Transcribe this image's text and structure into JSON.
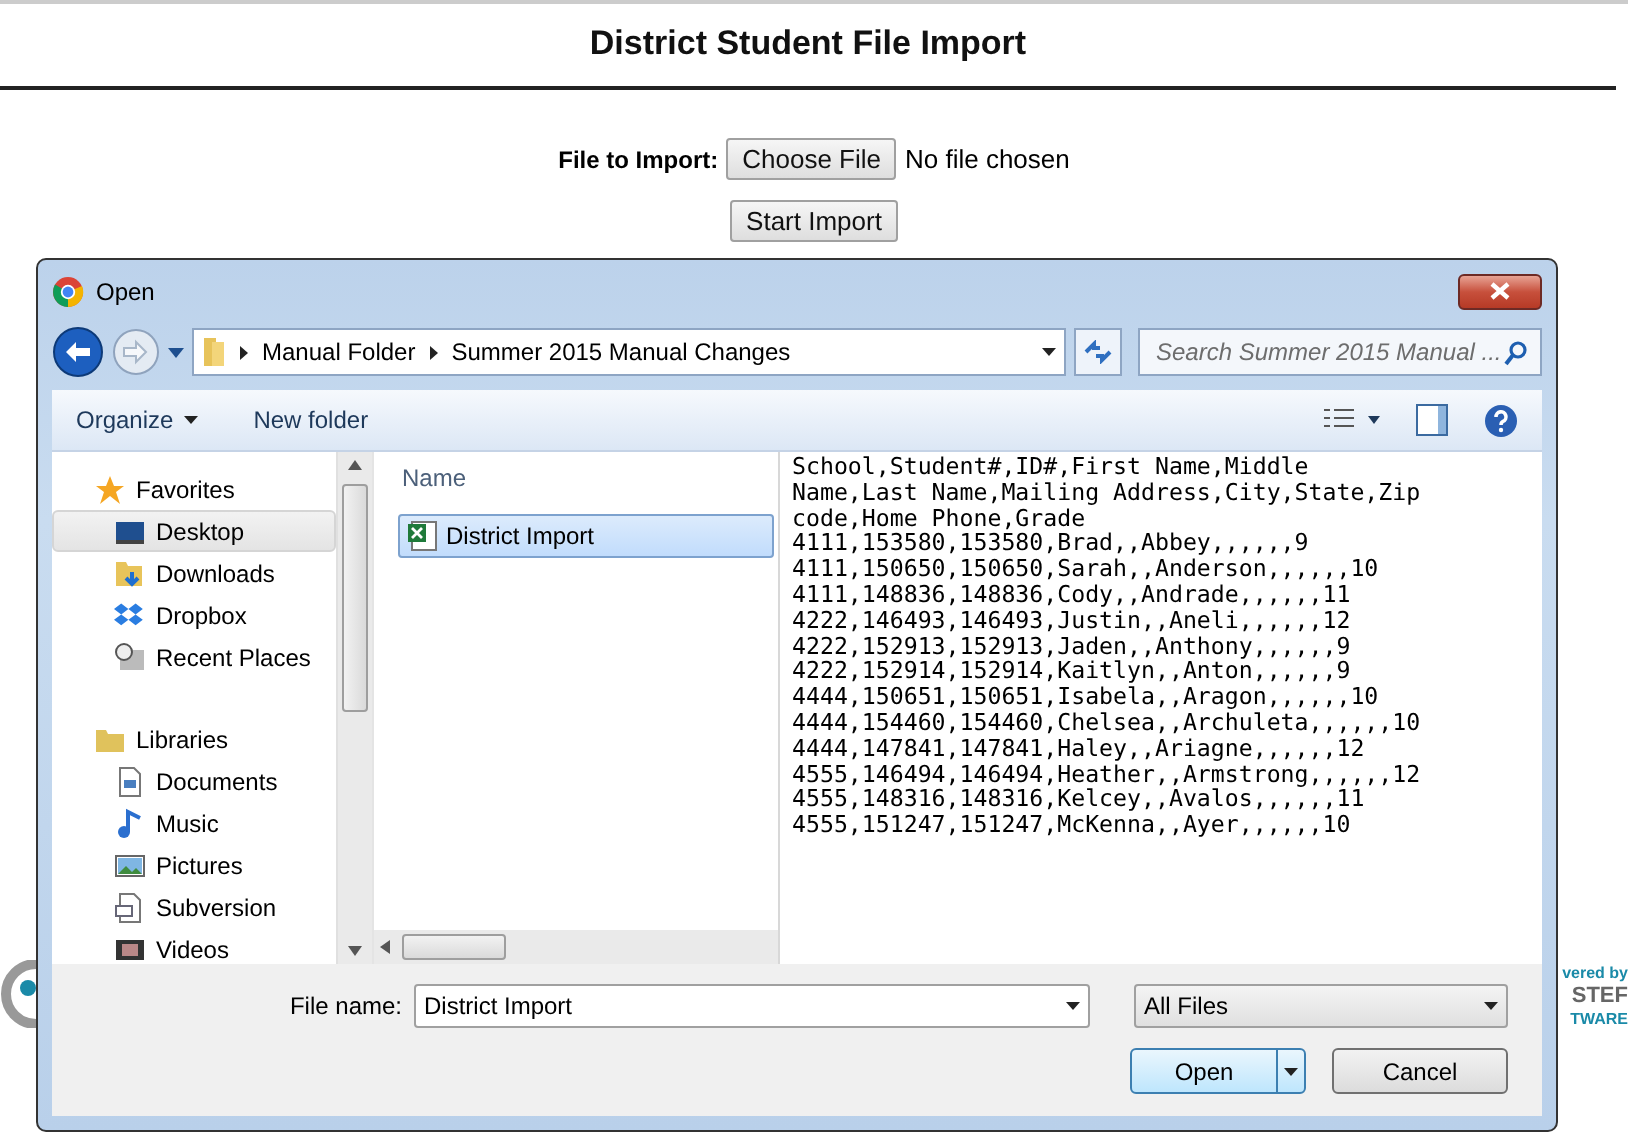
{
  "page": {
    "title": "District Student File Import",
    "file_label": "File to Import:",
    "choose_button": "Choose File",
    "no_file": "No file chosen",
    "start_button": "Start Import",
    "footer_text": [
      "vered by",
      "STEF",
      "TWARE"
    ]
  },
  "dialog": {
    "title": "Open",
    "breadcrumb": [
      "Manual Folder",
      "Summer 2015 Manual Changes"
    ],
    "search_placeholder": "Search Summer 2015 Manual ...",
    "toolbar": [
      "Organize",
      "New folder"
    ],
    "nav": [
      {
        "label": "Favorites",
        "kind": "group",
        "selected": false
      },
      {
        "label": "Desktop",
        "kind": "item",
        "selected": true
      },
      {
        "label": "Downloads",
        "kind": "item",
        "selected": false
      },
      {
        "label": "Dropbox",
        "kind": "item",
        "selected": false
      },
      {
        "label": "Recent Places",
        "kind": "item",
        "selected": false
      },
      {
        "label": "Libraries",
        "kind": "group",
        "selected": false
      },
      {
        "label": "Documents",
        "kind": "item",
        "selected": false
      },
      {
        "label": "Music",
        "kind": "item",
        "selected": false
      },
      {
        "label": "Pictures",
        "kind": "item",
        "selected": false
      },
      {
        "label": "Subversion",
        "kind": "item",
        "selected": false
      },
      {
        "label": "Videos",
        "kind": "item",
        "selected": false
      }
    ],
    "files": {
      "column": "Name",
      "items": [
        {
          "name": "District Import",
          "selected": true
        }
      ]
    },
    "preview": [
      "School,Student#,ID#,First Name,Middle",
      "Name,Last Name,Mailing Address,City,State,Zip",
      "code,Home Phone,Grade",
      "4111,153580,153580,Brad,,Abbey,,,,,,9",
      "4111,150650,150650,Sarah,,Anderson,,,,,,10",
      "4111,148836,148836,Cody,,Andrade,,,,,,11",
      "4222,146493,146493,Justin,,Aneli,,,,,,12",
      "4222,152913,152913,Jaden,,Anthony,,,,,,9",
      "4222,152914,152914,Kaitlyn,,Anton,,,,,,9",
      "4444,150651,150651,Isabela,,Aragon,,,,,,10",
      "4444,154460,154460,Chelsea,,Archuleta,,,,,,10",
      "4444,147841,147841,Haley,,Ariagne,,,,,,12",
      "4555,146494,146494,Heather,,Armstrong,,,,,,12",
      "4555,148316,148316,Kelcey,,Avalos,,,,,,11",
      "4555,151247,151247,McKenna,,Ayer,,,,,,10"
    ],
    "file_name_label": "File name:",
    "file_name": "District Import",
    "filter": "All Files",
    "buttons": [
      "Open",
      "Cancel"
    ]
  }
}
